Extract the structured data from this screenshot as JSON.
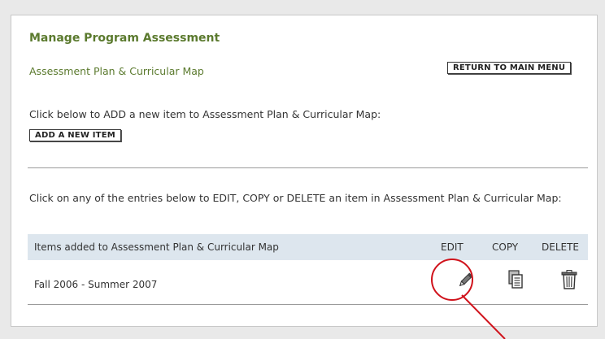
{
  "page": {
    "title": "Manage Program Assessment",
    "subtitle": "Assessment Plan & Curricular Map",
    "return_button": "RETURN TO MAIN MENU",
    "add_instruction": "Click below to ADD a new item to Assessment Plan & Curricular Map:",
    "add_button": "ADD A NEW ITEM",
    "entries_instruction": "Click on any of the entries below to EDIT, COPY or DELETE an item in Assessment Plan & Curricular Map:"
  },
  "table": {
    "headers": {
      "items": "Items added to Assessment Plan & Curricular Map",
      "edit": "EDIT",
      "copy": "COPY",
      "delete": "DELETE"
    },
    "rows": [
      {
        "name": "Fall 2006 - Summer 2007",
        "edit_icon": "pencil-icon",
        "copy_icon": "copy-icon",
        "delete_icon": "trash-icon"
      }
    ]
  },
  "colors": {
    "title": "#5b7a2e",
    "header_bg": "#dde6ee",
    "callout": "#d0121b"
  }
}
